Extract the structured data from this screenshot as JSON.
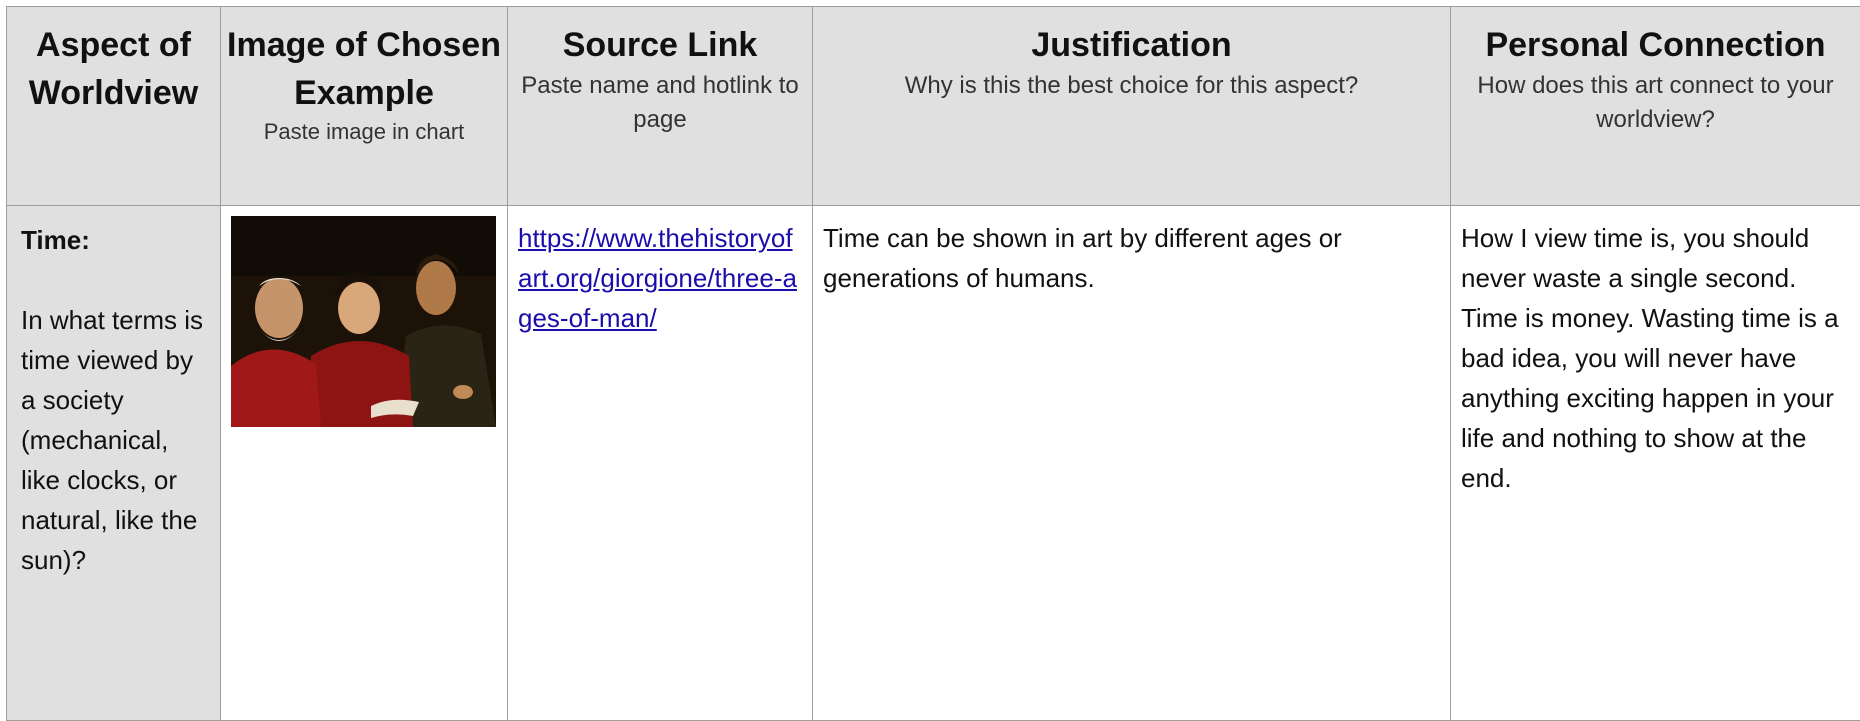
{
  "headers": {
    "aspect": {
      "title": "Aspect of Worldview",
      "sub": ""
    },
    "image": {
      "title": "Image of Chosen Example",
      "sub": "Paste image in chart"
    },
    "source": {
      "title": "Source Link",
      "sub": "Paste name and hotlink to page"
    },
    "justification": {
      "title": "Justification",
      "sub": "Why is this the best choice for this aspect?"
    },
    "personal": {
      "title": "Personal Connection",
      "sub": "How does this art connect to your worldview?"
    }
  },
  "row": {
    "aspect_title": "Time:",
    "aspect_question": "In what terms is time viewed by a society (mechanical, like clocks, or natural, like the sun)?",
    "image_icon": "painting-three-men",
    "source_link": "https://www.thehistoryofart.org/giorgione/three-ages-of-man/",
    "justification": "Time can be shown in art by different ages or generations of humans.",
    "personal": "How I view time is, you should never waste a single second. Time is money. Wasting time is a bad idea, you will never have anything exciting happen in your life and nothing to show at the end."
  },
  "colors": {
    "header_bg": "#e0e0e0",
    "link": "#1a0dab",
    "border": "#9e9e9e"
  }
}
